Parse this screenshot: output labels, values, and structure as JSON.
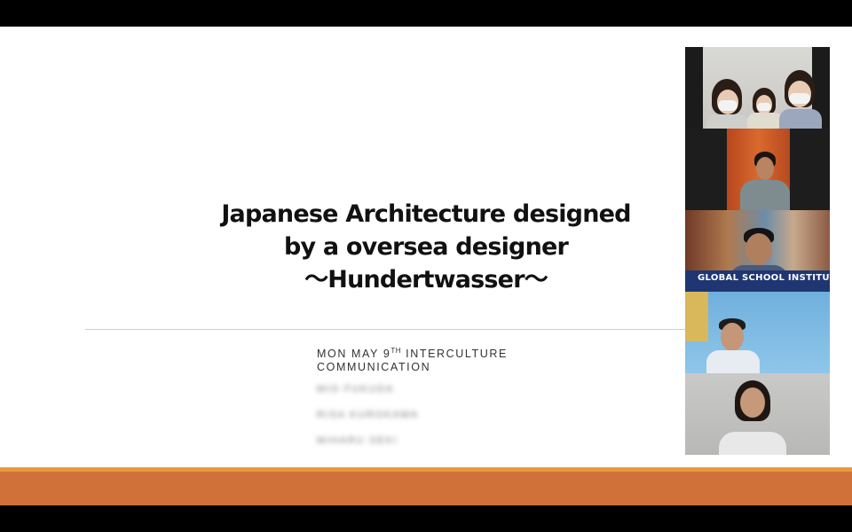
{
  "slide": {
    "title_lines": [
      "Japanese Architecture designed",
      "by a oversea designer",
      "～Hundertwasser～"
    ],
    "subtitle_pre": "MON MAY 9",
    "subtitle_sup": "TH",
    "subtitle_post": " INTERCULTURE COMMUNICATION",
    "presenters_blurred": [
      "MIO FUKUDA",
      "RISA KUROKAWA",
      "MIHARU SEKI"
    ]
  },
  "colors": {
    "accent_stripe": "#e79a3c",
    "footer_bar": "#d0713a",
    "background": "#ffffff"
  },
  "gallery": {
    "tiles": [
      {
        "name": "participant-video-1"
      },
      {
        "name": "participant-video-2"
      },
      {
        "name": "participant-video-3",
        "banner_text": "GLOBAL SCHOOL INSTITUTE"
      },
      {
        "name": "participant-video-4"
      },
      {
        "name": "participant-video-5"
      }
    ]
  }
}
